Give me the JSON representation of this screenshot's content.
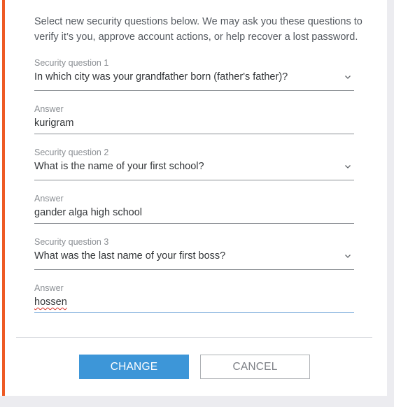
{
  "intro_text": "Select new security questions below. We may ask you these questions to verify it’s you, approve account actions, or help recover a lost password.",
  "questions": [
    {
      "question_label": "Security question 1",
      "question_value": "In which city was your grandfather born (father's father)?",
      "answer_label": "Answer",
      "answer_value": "kurigram"
    },
    {
      "question_label": "Security question 2",
      "question_value": "What is the name of your first school?",
      "answer_label": "Answer",
      "answer_value": "gander alga high school"
    },
    {
      "question_label": "Security question 3",
      "question_value": "What was the last name of your first boss?",
      "answer_label": "Answer",
      "answer_value": "hossen"
    }
  ],
  "actions": {
    "change_label": "CHANGE",
    "cancel_label": "CANCEL"
  },
  "colors": {
    "accent": "#ee5a24",
    "primary_button": "#3d96d8",
    "focus_underline": "#6ea4d8",
    "spellcheck_underline": "#d93025"
  },
  "icons": {
    "dropdown": "chevron-down-icon"
  }
}
